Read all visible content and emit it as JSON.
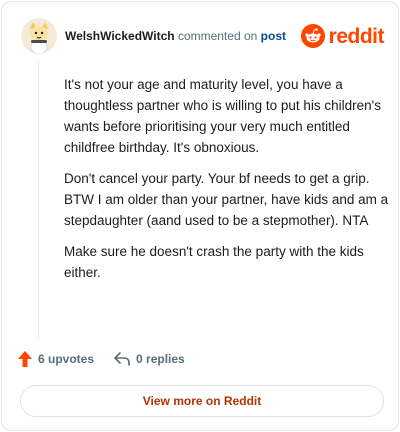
{
  "header": {
    "username": "WelshWickedWitch",
    "verb": "commented on",
    "post_link": "post",
    "avatar_icon": "cat-avatar-icon",
    "brand_icon": "reddit-logo-icon",
    "brand_text": "reddit"
  },
  "comment": {
    "paragraphs": [
      "It's not your age and maturity level, you have a thoughtless partner who is willing to put his children's wants before prioritising your very much entitled childfree birthday. It's obnoxious.",
      "Don't cancel your party. Your bf needs to get a grip. BTW I am older than your partner, have kids and am a stepdaughter (aand used to be a stepmother). NTA",
      "Make sure he doesn't crash the party with the kids either."
    ]
  },
  "actions": {
    "upvotes_label": "6 upvotes",
    "replies_label": "0 replies",
    "upvote_icon": "upvote-arrow-icon",
    "reply_icon": "reply-arrow-icon"
  },
  "footer": {
    "view_more_label": "View more on Reddit"
  },
  "colors": {
    "brand": "#ff4500",
    "link": "#0a4a8c",
    "view_more_text": "#b23300"
  }
}
